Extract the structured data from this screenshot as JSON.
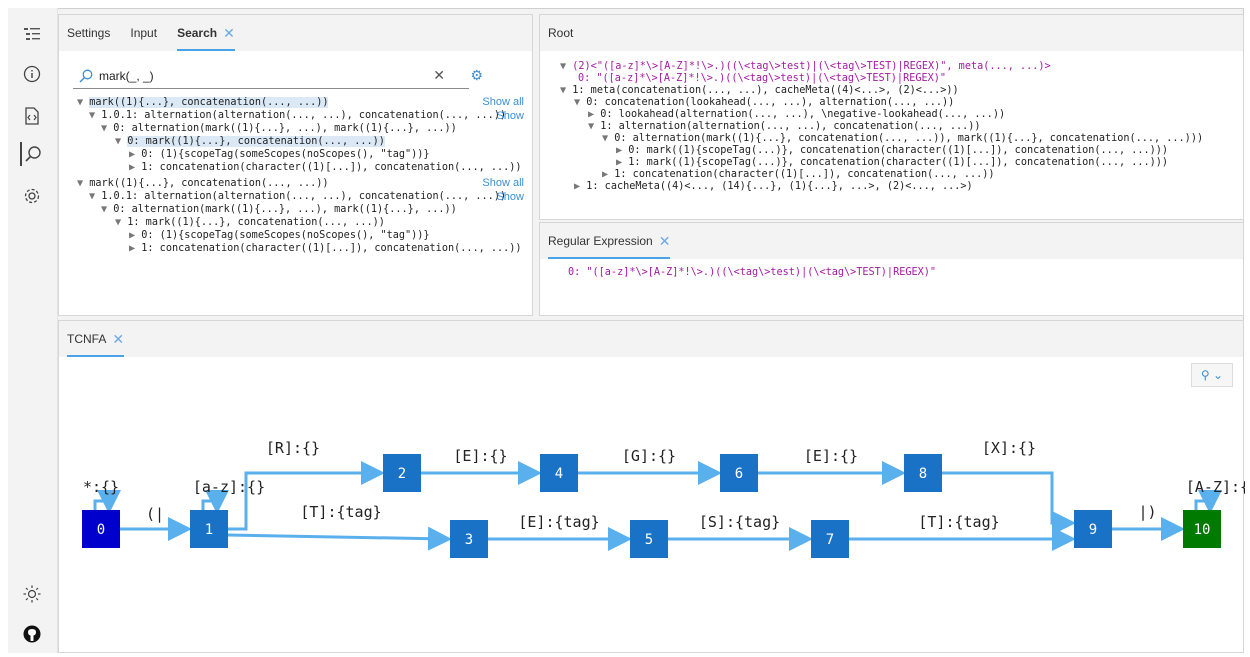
{
  "rail": {
    "icons": [
      "outline-icon",
      "info-icon",
      "code-file-icon",
      "search-icon",
      "settings-gear-icon"
    ],
    "bottom_icons": [
      "theme-sun-icon",
      "github-icon"
    ]
  },
  "search_panel": {
    "tabs": [
      {
        "label": "Settings"
      },
      {
        "label": "Input"
      },
      {
        "label": "Search",
        "close": "✕"
      }
    ],
    "query": "mark(_, _)",
    "show_all": "Show all",
    "show": "Show",
    "lines": [
      "mark((1){...}, concatenation(..., ...))",
      "1.0.1: alternation(alternation(..., ...), concatenation(..., ...))",
      "0: alternation(mark((1){...}, ...), mark((1){...}, ...))",
      "0: mark((1){...}, concatenation(..., ...))",
      "0: (1){scopeTag(someScopes(noScopes(), \"tag\"))}",
      "1: concatenation(character((1)[...]), concatenation(..., ...))",
      "mark((1){...}, concatenation(..., ...))",
      "1.0.1: alternation(alternation(..., ...), concatenation(..., ...))",
      "0: alternation(mark((1){...}, ...), mark((1){...}, ...))",
      "1: mark((1){...}, concatenation(..., ...))",
      "0: (1){scopeTag(someScopes(noScopes(), \"tag\"))}",
      "1: concatenation(character((1)[...]), concatenation(..., ...))"
    ]
  },
  "root_panel": {
    "title": "Root",
    "lines": [
      "(2)<\"([a-z]*\\>[A-Z]*!\\>.)((\\<tag\\>test)|(\\<tag\\>TEST)|REGEX)\", meta(..., ...)>",
      "0: \"([a-z]*\\>[A-Z]*!\\>.)((\\<tag\\>test)|(\\<tag\\>TEST)|REGEX)\"",
      "1: meta(concatenation(..., ...), cacheMeta((4)<...>, (2)<...>))",
      "0: concatenation(lookahead(..., ...), alternation(..., ...))",
      "0: lookahead(alternation(..., ...), \\negative-lookahead(..., ...))",
      "1: alternation(alternation(..., ...), concatenation(..., ...))",
      "0: alternation(mark((1){...}, concatenation(..., ...)), mark((1){...}, concatenation(..., ...)))",
      "0: mark((1){scopeTag(...)}, concatenation(character((1)[...]), concatenation(..., ...)))",
      "1: mark((1){scopeTag(...)}, concatenation(character((1)[...]), concatenation(..., ...)))",
      "1: concatenation(character((1)[...]), concatenation(..., ...))",
      "1: cacheMeta((4)<..., (14){...}, (1){...}, ...>, (2)<..., ...>)"
    ]
  },
  "regex_panel": {
    "title": "Regular Expression",
    "close": "✕",
    "line": "0: \"([a-z]*\\>[A-Z]*!\\>.)((\\<tag\\>test)|(\\<tag\\>TEST)|REGEX)\""
  },
  "tcnfa_panel": {
    "title": "TCNFA",
    "close": "✕",
    "layout_button": "layout-dropdown-icon",
    "nodes": [
      "0",
      "1",
      "2",
      "3",
      "4",
      "5",
      "6",
      "7",
      "8",
      "9",
      "10"
    ],
    "edges": [
      {
        "from": "0",
        "to": "0",
        "label": "*:{}"
      },
      {
        "from": "1",
        "to": "1",
        "label": "[a-z]:{}"
      },
      {
        "from": "0",
        "to": "1",
        "label": "(|"
      },
      {
        "from": "1",
        "to": "2",
        "label": "[R]:{}"
      },
      {
        "from": "1",
        "to": "3",
        "label": "[T]:{tag}"
      },
      {
        "from": "2",
        "to": "4",
        "label": "[E]:{}"
      },
      {
        "from": "4",
        "to": "6",
        "label": "[G]:{}"
      },
      {
        "from": "6",
        "to": "8",
        "label": "[E]:{}"
      },
      {
        "from": "8",
        "to": "9",
        "label": "[X]:{}"
      },
      {
        "from": "3",
        "to": "5",
        "label": "[E]:{tag}"
      },
      {
        "from": "5",
        "to": "7",
        "label": "[S]:{tag}"
      },
      {
        "from": "7",
        "to": "9",
        "label": "[T]:{tag}"
      },
      {
        "from": "9",
        "to": "10",
        "label": "|)"
      },
      {
        "from": "10",
        "to": "10",
        "label": "[A-Z]:{}"
      }
    ],
    "colors": {
      "start": "#0000cc",
      "accept": "#007a00",
      "state": "#1a72c7",
      "edge": "#5ab0ec"
    }
  }
}
